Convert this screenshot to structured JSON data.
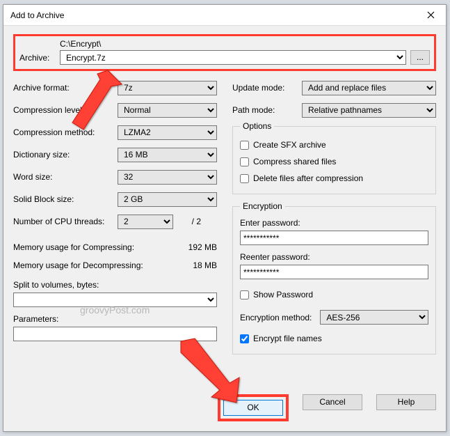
{
  "title": "Add to Archive",
  "archive": {
    "label": "Archive:",
    "path": "C:\\Encrypt\\",
    "filename": "Encrypt.7z",
    "browse": "..."
  },
  "left": {
    "format_label": "Archive format:",
    "format": "7z",
    "clevel_label": "Compression level:",
    "clevel": "Normal",
    "cmethod_label": "Compression method:",
    "cmethod": "LZMA2",
    "dict_label": "Dictionary size:",
    "dict": "16 MB",
    "word_label": "Word size:",
    "word": "32",
    "solid_label": "Solid Block size:",
    "solid": "2 GB",
    "threads_label": "Number of CPU threads:",
    "threads": "2",
    "threads_max": "/ 2",
    "mem_comp_label": "Memory usage for Compressing:",
    "mem_comp": "192 MB",
    "mem_decomp_label": "Memory usage for Decompressing:",
    "mem_decomp": "18 MB",
    "split_label": "Split to volumes, bytes:",
    "params_label": "Parameters:"
  },
  "right": {
    "update_label": "Update mode:",
    "update": "Add and replace files",
    "pathmode_label": "Path mode:",
    "pathmode": "Relative pathnames",
    "options_legend": "Options",
    "opt_sfx": "Create SFX archive",
    "opt_shared": "Compress shared files",
    "opt_delete": "Delete files after compression",
    "enc_legend": "Encryption",
    "enter_pw": "Enter password:",
    "reenter_pw": "Reenter password:",
    "pw_mask": "***********",
    "show_pw": "Show Password",
    "enc_method_label": "Encryption method:",
    "enc_method": "AES-256",
    "enc_names": "Encrypt file names"
  },
  "buttons": {
    "ok": "OK",
    "cancel": "Cancel",
    "help": "Help"
  },
  "watermark": "groovyPost.com"
}
